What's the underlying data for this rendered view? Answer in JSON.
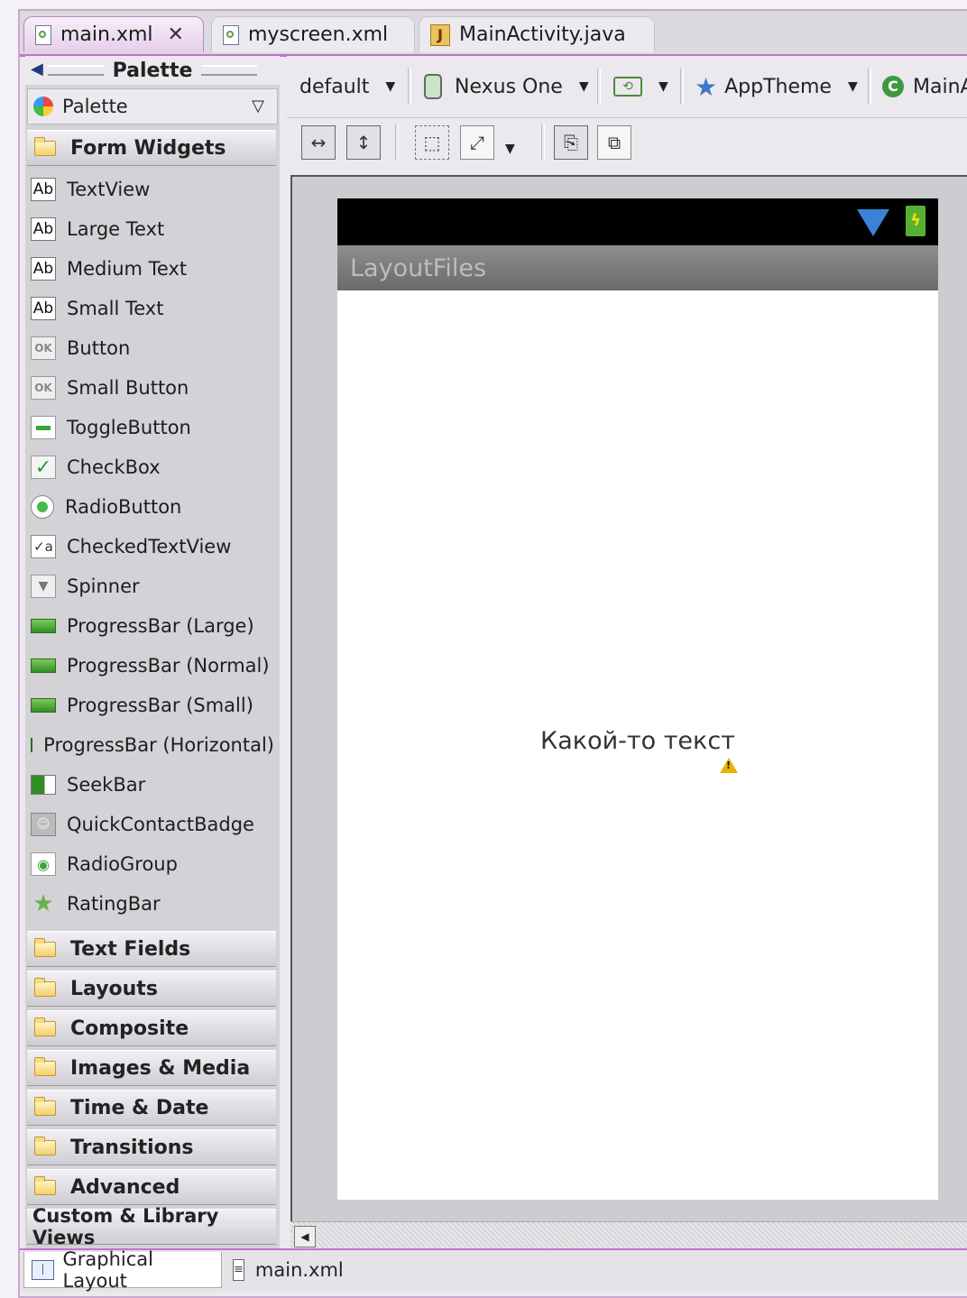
{
  "editor_tabs": [
    {
      "label": "main.xml",
      "active": true,
      "icon": "xml-file-icon",
      "closable": true
    },
    {
      "label": "myscreen.xml",
      "active": false,
      "icon": "xml-file-icon"
    },
    {
      "label": "MainActivity.java",
      "active": false,
      "icon": "java-file-icon"
    }
  ],
  "palette": {
    "header": "Palette",
    "selector_label": "Palette",
    "expanded_category": "Form Widgets",
    "form_widgets": [
      {
        "label": "TextView",
        "icon": "ab-icon"
      },
      {
        "label": "Large Text",
        "icon": "ab-icon"
      },
      {
        "label": "Medium Text",
        "icon": "ab-icon"
      },
      {
        "label": "Small Text",
        "icon": "ab-icon"
      },
      {
        "label": "Button",
        "icon": "ok-button-icon"
      },
      {
        "label": "Small Button",
        "icon": "ok-button-icon"
      },
      {
        "label": "ToggleButton",
        "icon": "toggle-icon"
      },
      {
        "label": "CheckBox",
        "icon": "checkbox-icon"
      },
      {
        "label": "RadioButton",
        "icon": "radio-icon"
      },
      {
        "label": "CheckedTextView",
        "icon": "checked-textview-icon"
      },
      {
        "label": "Spinner",
        "icon": "spinner-icon"
      },
      {
        "label": "ProgressBar (Large)",
        "icon": "progressbar-icon"
      },
      {
        "label": "ProgressBar (Normal)",
        "icon": "progressbar-icon"
      },
      {
        "label": "ProgressBar (Small)",
        "icon": "progressbar-icon"
      },
      {
        "label": "ProgressBar (Horizontal)",
        "icon": "progressbar-icon"
      },
      {
        "label": "SeekBar",
        "icon": "seekbar-icon"
      },
      {
        "label": "QuickContactBadge",
        "icon": "contact-badge-icon"
      },
      {
        "label": "RadioGroup",
        "icon": "radiogroup-icon"
      },
      {
        "label": "RatingBar",
        "icon": "star-icon"
      }
    ],
    "collapsed_categories": [
      "Text Fields",
      "Layouts",
      "Composite",
      "Images & Media",
      "Time & Date",
      "Transitions",
      "Advanced"
    ],
    "custom_views": "Custom & Library Views"
  },
  "toolbar": {
    "config": "default",
    "device": "Nexus One",
    "theme": "AppTheme",
    "activity": "MainA"
  },
  "device_preview": {
    "app_title": "LayoutFiles",
    "content_text": "Какой-то текст"
  },
  "bottom_tabs": [
    {
      "label": "Graphical Layout",
      "active": true
    },
    {
      "label": "main.xml",
      "active": false
    }
  ],
  "colors": {
    "accent": "#c46fd0",
    "progress_green": "#2f8f24",
    "status_bar": "#000000",
    "title_bar": "#7a7a7a"
  }
}
